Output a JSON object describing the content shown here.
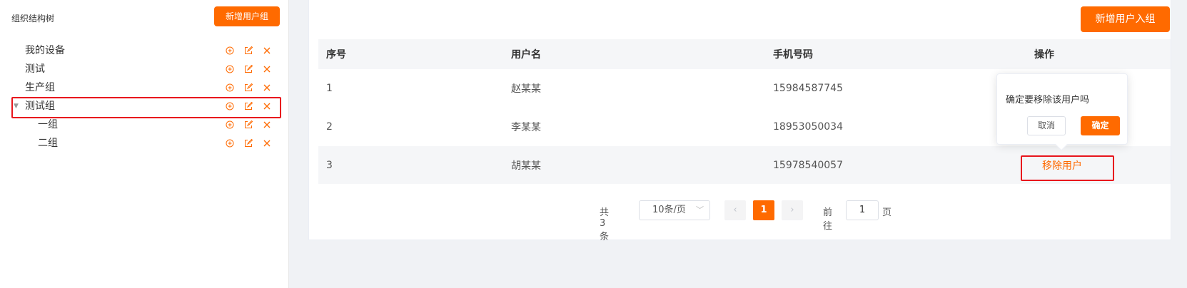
{
  "sidebar": {
    "title": "组织结构树",
    "add_group_button": "新增用户组",
    "tree": [
      {
        "label": "我的设备",
        "level": 0,
        "expanded": false
      },
      {
        "label": "测试",
        "level": 0,
        "expanded": false
      },
      {
        "label": "生产组",
        "level": 0,
        "expanded": false
      },
      {
        "label": "测试组",
        "level": 0,
        "expanded": true
      },
      {
        "label": "一组",
        "level": 1,
        "expanded": false
      },
      {
        "label": "二组",
        "level": 1,
        "expanded": false
      }
    ],
    "icons": {
      "add": "circle-plus-icon",
      "edit": "edit-icon",
      "delete": "close-icon"
    }
  },
  "main": {
    "add_user_button": "新增用户入组",
    "table": {
      "headers": [
        "序号",
        "用户名",
        "手机号码",
        "操作"
      ],
      "rows": [
        {
          "index": "1",
          "name": "赵某某",
          "phone": "15984587745",
          "action": ""
        },
        {
          "index": "2",
          "name": "李某某",
          "phone": "18953050034",
          "action": ""
        },
        {
          "index": "3",
          "name": "胡某某",
          "phone": "15978540057",
          "action": "移除用户"
        }
      ]
    },
    "popover": {
      "message": "确定要移除该用户吗",
      "cancel": "取消",
      "confirm": "确定"
    },
    "pagination": {
      "total": "共 3 条",
      "page_size": "10条/页",
      "current_page": "1",
      "goto_label": "前往",
      "goto_value": "1",
      "page_suffix": "页"
    }
  },
  "colors": {
    "accent": "#ff6a00",
    "highlight": "#e8151d"
  }
}
